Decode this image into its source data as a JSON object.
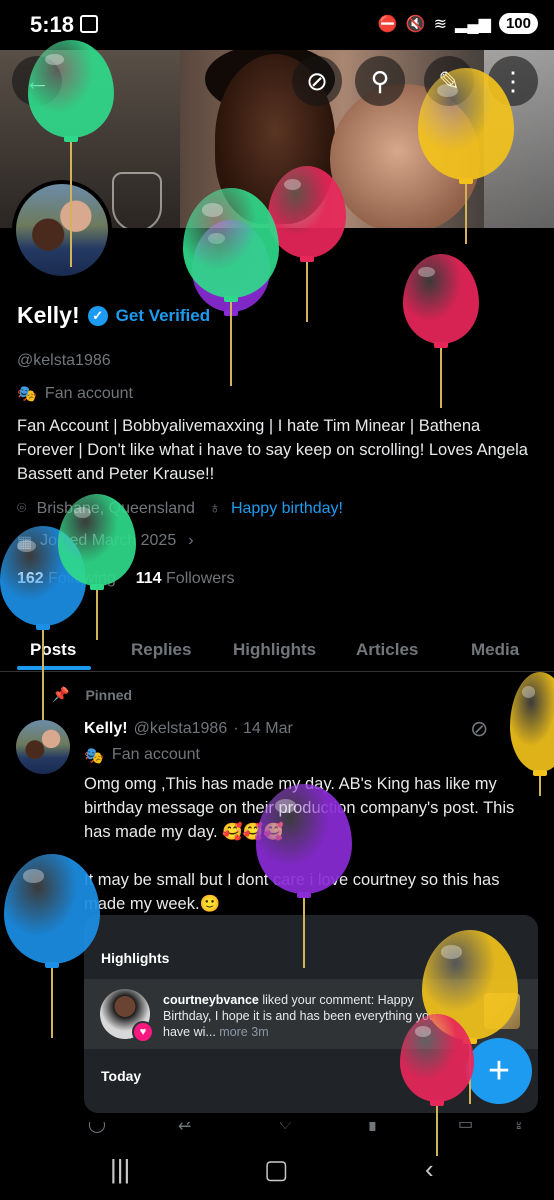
{
  "status_bar": {
    "time": "5:18",
    "battery": "100"
  },
  "header": {
    "back_icon": "back-arrow-icon",
    "grok_icon": "grok-icon",
    "search_icon": "search-icon",
    "edit_icon": "pen-icon",
    "more_icon": "more-vertical-icon"
  },
  "profile": {
    "name": "Kelly!",
    "get_verified": "Get Verified",
    "handle": "@kelsta1986",
    "label": "Fan account",
    "bio": "Fan Account | Bobbyalivemaxxing | I hate Tim Minear | Bathena Forever | Don't like what i have to say keep on scrolling! Loves Angela Bassett and Peter Krause!!",
    "location": "Brisbane, Queensland",
    "website": "Happy birthday!",
    "joined": "Joined March 2025",
    "following_count": "162",
    "following_label": "Following",
    "followers_count": "114",
    "followers_label": "Followers"
  },
  "tabs": [
    "Posts",
    "Replies",
    "Highlights",
    "Articles",
    "Media"
  ],
  "active_tab": "Posts",
  "post": {
    "pinned_label": "Pinned",
    "author": "Kelly!",
    "handle": "@kelsta1986",
    "date": "· 14 Mar",
    "label": "Fan account",
    "text": "Omg omg ,This has made my day. AB's King has like my birthday message  on their production company's post. This has made my day. 🥰🥰🥰\n\nIt may be small but I dont care i love courtney so this has made my week.🙂",
    "card": {
      "section_title": "Highlights",
      "notif_user": "courtneybvance",
      "notif_text": " liked your comment: Happy Birthday, I hope it is and has been everything you have wi... ",
      "notif_more": "more",
      "notif_time": "3m",
      "today_label": "Today"
    }
  },
  "fab_label": "+",
  "colors": {
    "accent": "#1d9bf0",
    "background": "#000000",
    "muted": "#71767b"
  }
}
